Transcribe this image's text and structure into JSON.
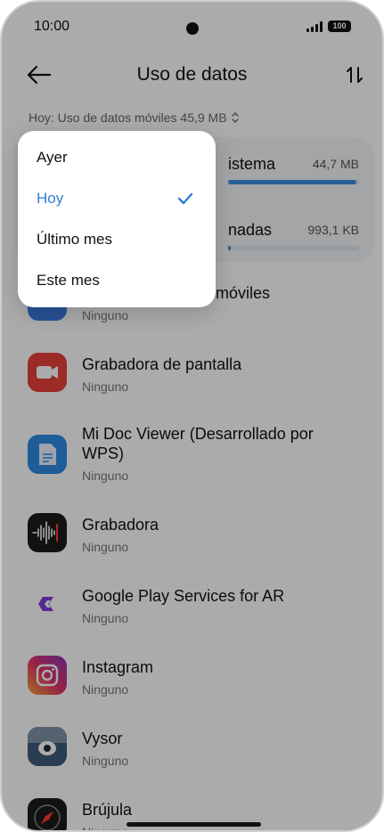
{
  "status_bar": {
    "time": "10:00",
    "battery": "100"
  },
  "header": {
    "title": "Uso de datos"
  },
  "summary": {
    "text": "Hoy: Uso de datos móviles 45,9 MB"
  },
  "card": {
    "rows": [
      {
        "label": "istema",
        "value": "44,7 MB",
        "fraction": 0.98
      },
      {
        "label": "nadas",
        "value": "993,1 KB",
        "fraction": 0.02
      }
    ]
  },
  "apps": [
    {
      "name": "móviles",
      "usage": "Ninguno"
    },
    {
      "name": "Grabadora de pantalla",
      "usage": "Ninguno"
    },
    {
      "name": "Mi Doc Viewer (Desarrollado por WPS)",
      "usage": "Ninguno"
    },
    {
      "name": "Grabadora",
      "usage": "Ninguno"
    },
    {
      "name": "Google Play Services for AR",
      "usage": "Ninguno"
    },
    {
      "name": "Instagram",
      "usage": "Ninguno"
    },
    {
      "name": "Vysor",
      "usage": "Ninguno"
    },
    {
      "name": "Brújula",
      "usage": "Ninguno"
    }
  ],
  "dropdown": {
    "options": [
      "Ayer",
      "Hoy",
      "Último mes",
      "Este mes"
    ],
    "selected": "Hoy",
    "accent_color": "#2f7fd8"
  }
}
